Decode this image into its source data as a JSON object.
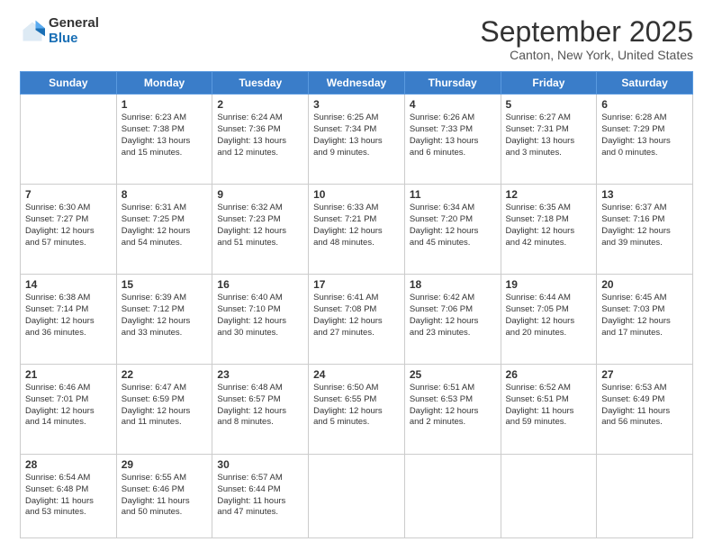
{
  "logo": {
    "general": "General",
    "blue": "Blue"
  },
  "header": {
    "month": "September 2025",
    "location": "Canton, New York, United States"
  },
  "weekdays": [
    "Sunday",
    "Monday",
    "Tuesday",
    "Wednesday",
    "Thursday",
    "Friday",
    "Saturday"
  ],
  "weeks": [
    [
      {
        "day": "",
        "content": ""
      },
      {
        "day": "1",
        "content": "Sunrise: 6:23 AM\nSunset: 7:38 PM\nDaylight: 13 hours\nand 15 minutes."
      },
      {
        "day": "2",
        "content": "Sunrise: 6:24 AM\nSunset: 7:36 PM\nDaylight: 13 hours\nand 12 minutes."
      },
      {
        "day": "3",
        "content": "Sunrise: 6:25 AM\nSunset: 7:34 PM\nDaylight: 13 hours\nand 9 minutes."
      },
      {
        "day": "4",
        "content": "Sunrise: 6:26 AM\nSunset: 7:33 PM\nDaylight: 13 hours\nand 6 minutes."
      },
      {
        "day": "5",
        "content": "Sunrise: 6:27 AM\nSunset: 7:31 PM\nDaylight: 13 hours\nand 3 minutes."
      },
      {
        "day": "6",
        "content": "Sunrise: 6:28 AM\nSunset: 7:29 PM\nDaylight: 13 hours\nand 0 minutes."
      }
    ],
    [
      {
        "day": "7",
        "content": "Sunrise: 6:30 AM\nSunset: 7:27 PM\nDaylight: 12 hours\nand 57 minutes."
      },
      {
        "day": "8",
        "content": "Sunrise: 6:31 AM\nSunset: 7:25 PM\nDaylight: 12 hours\nand 54 minutes."
      },
      {
        "day": "9",
        "content": "Sunrise: 6:32 AM\nSunset: 7:23 PM\nDaylight: 12 hours\nand 51 minutes."
      },
      {
        "day": "10",
        "content": "Sunrise: 6:33 AM\nSunset: 7:21 PM\nDaylight: 12 hours\nand 48 minutes."
      },
      {
        "day": "11",
        "content": "Sunrise: 6:34 AM\nSunset: 7:20 PM\nDaylight: 12 hours\nand 45 minutes."
      },
      {
        "day": "12",
        "content": "Sunrise: 6:35 AM\nSunset: 7:18 PM\nDaylight: 12 hours\nand 42 minutes."
      },
      {
        "day": "13",
        "content": "Sunrise: 6:37 AM\nSunset: 7:16 PM\nDaylight: 12 hours\nand 39 minutes."
      }
    ],
    [
      {
        "day": "14",
        "content": "Sunrise: 6:38 AM\nSunset: 7:14 PM\nDaylight: 12 hours\nand 36 minutes."
      },
      {
        "day": "15",
        "content": "Sunrise: 6:39 AM\nSunset: 7:12 PM\nDaylight: 12 hours\nand 33 minutes."
      },
      {
        "day": "16",
        "content": "Sunrise: 6:40 AM\nSunset: 7:10 PM\nDaylight: 12 hours\nand 30 minutes."
      },
      {
        "day": "17",
        "content": "Sunrise: 6:41 AM\nSunset: 7:08 PM\nDaylight: 12 hours\nand 27 minutes."
      },
      {
        "day": "18",
        "content": "Sunrise: 6:42 AM\nSunset: 7:06 PM\nDaylight: 12 hours\nand 23 minutes."
      },
      {
        "day": "19",
        "content": "Sunrise: 6:44 AM\nSunset: 7:05 PM\nDaylight: 12 hours\nand 20 minutes."
      },
      {
        "day": "20",
        "content": "Sunrise: 6:45 AM\nSunset: 7:03 PM\nDaylight: 12 hours\nand 17 minutes."
      }
    ],
    [
      {
        "day": "21",
        "content": "Sunrise: 6:46 AM\nSunset: 7:01 PM\nDaylight: 12 hours\nand 14 minutes."
      },
      {
        "day": "22",
        "content": "Sunrise: 6:47 AM\nSunset: 6:59 PM\nDaylight: 12 hours\nand 11 minutes."
      },
      {
        "day": "23",
        "content": "Sunrise: 6:48 AM\nSunset: 6:57 PM\nDaylight: 12 hours\nand 8 minutes."
      },
      {
        "day": "24",
        "content": "Sunrise: 6:50 AM\nSunset: 6:55 PM\nDaylight: 12 hours\nand 5 minutes."
      },
      {
        "day": "25",
        "content": "Sunrise: 6:51 AM\nSunset: 6:53 PM\nDaylight: 12 hours\nand 2 minutes."
      },
      {
        "day": "26",
        "content": "Sunrise: 6:52 AM\nSunset: 6:51 PM\nDaylight: 11 hours\nand 59 minutes."
      },
      {
        "day": "27",
        "content": "Sunrise: 6:53 AM\nSunset: 6:49 PM\nDaylight: 11 hours\nand 56 minutes."
      }
    ],
    [
      {
        "day": "28",
        "content": "Sunrise: 6:54 AM\nSunset: 6:48 PM\nDaylight: 11 hours\nand 53 minutes."
      },
      {
        "day": "29",
        "content": "Sunrise: 6:55 AM\nSunset: 6:46 PM\nDaylight: 11 hours\nand 50 minutes."
      },
      {
        "day": "30",
        "content": "Sunrise: 6:57 AM\nSunset: 6:44 PM\nDaylight: 11 hours\nand 47 minutes."
      },
      {
        "day": "",
        "content": ""
      },
      {
        "day": "",
        "content": ""
      },
      {
        "day": "",
        "content": ""
      },
      {
        "day": "",
        "content": ""
      }
    ]
  ]
}
